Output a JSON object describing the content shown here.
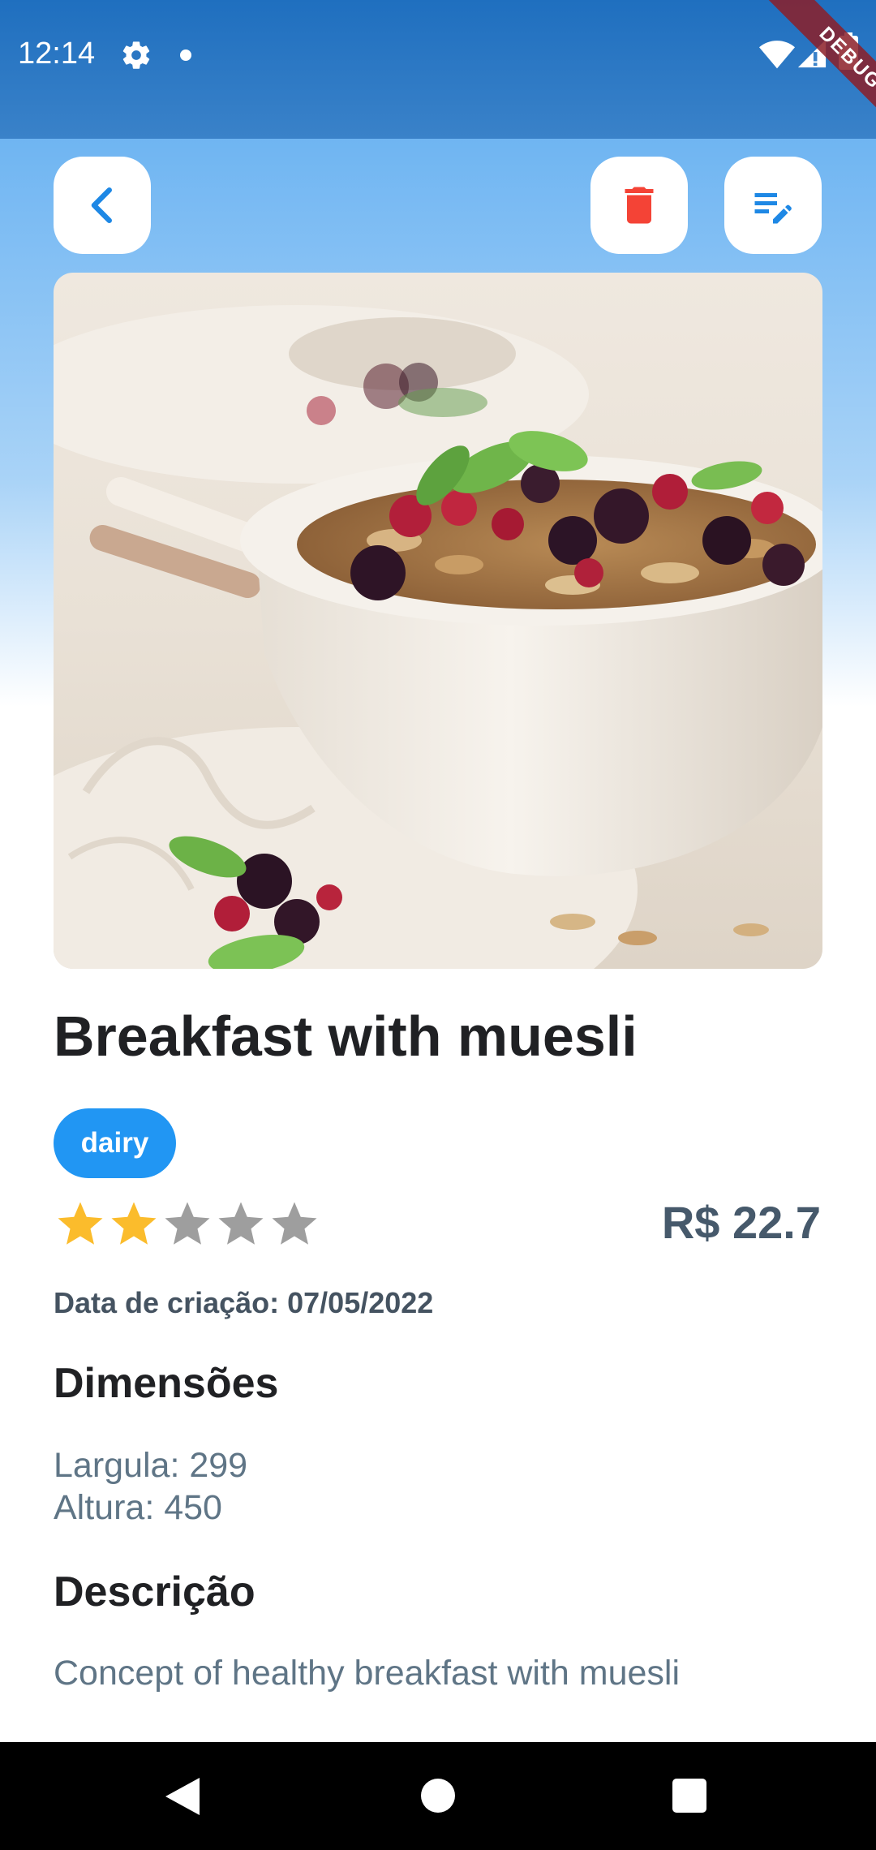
{
  "status_bar": {
    "time": "12:14",
    "icons": [
      "gear-icon",
      "notification-dot-icon",
      "wifi-icon",
      "signal-icon",
      "battery-icon"
    ]
  },
  "debug_banner": {
    "label": "DEBUG"
  },
  "toolbar": {
    "back_icon": "chevron-left-icon",
    "delete_icon": "trash-icon",
    "edit_icon": "edit-note-icon",
    "accent_color": "#1e88e5",
    "delete_color": "#f44336"
  },
  "product": {
    "title": "Breakfast with muesli",
    "tag": "dairy",
    "rating": 2,
    "rating_max": 5,
    "price": "R$ 22.7",
    "created_date": "Data de criação: 07/05/2022",
    "dimensions_title": "Dimensões",
    "width": "Largula: 299",
    "height": "Altura: 450",
    "description_title": "Descrição",
    "description": "Concept of healthy breakfast with muesli"
  },
  "colors": {
    "tag_background": "#2196f3",
    "star_filled": "#fbbc2c",
    "star_empty": "#9e9e9e",
    "price": "#46596b",
    "body_text": "#5f7586"
  },
  "nav_bar": {
    "icons": [
      "nav-back-icon",
      "nav-home-icon",
      "nav-recents-icon"
    ]
  }
}
